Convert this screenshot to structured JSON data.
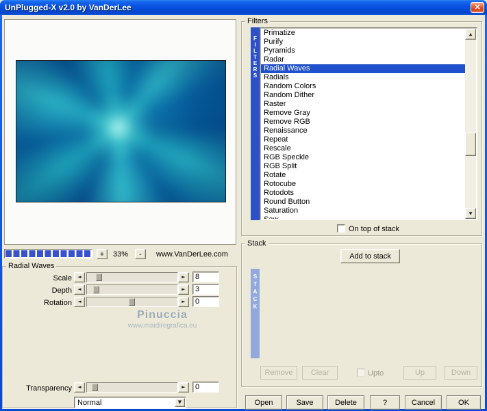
{
  "window": {
    "title": "UnPlugged-X v2.0 by VanDerLee"
  },
  "icons": {
    "close": "×",
    "left_arrow": "◄",
    "right_arrow": "►",
    "up_arrow": "▲",
    "down_arrow": "▼",
    "dropdown_arrow": "▼"
  },
  "preview": {
    "zoom_in_label": "+",
    "zoom_out_label": "-",
    "zoom_level": "33%",
    "website": "www.VanDerLee.com"
  },
  "radial_waves_panel": {
    "group_label": "Radial Waves",
    "params": [
      {
        "label": "Scale",
        "value": "8"
      },
      {
        "label": "Depth",
        "value": "3"
      },
      {
        "label": "Rotation",
        "value": "0"
      }
    ],
    "transparency": {
      "label": "Transparency",
      "value": "0"
    },
    "blend_mode": "Normal",
    "watermark": {
      "title": "Pinuccia",
      "url": "www.maidiregrafica.eu"
    }
  },
  "filters_panel": {
    "group_label": "Filters",
    "side_tab": "FILTERS",
    "selected": "Radial Waves",
    "items": [
      "Primatize",
      "Purify",
      "Pyramids",
      "Radar",
      "Radial Waves",
      "Radials",
      "Random Colors",
      "Random Dither",
      "Raster",
      "Remove Gray",
      "Remove RGB",
      "Renaissance",
      "Repeat",
      "Rescale",
      "RGB Speckle",
      "RGB Split",
      "Rotate",
      "Rotocube",
      "Rotodots",
      "Round Button",
      "Saturation",
      "Saw"
    ],
    "on_top_label": "On top of stack"
  },
  "stack_panel": {
    "group_label": "Stack",
    "side_tab": "STACK",
    "add_button": "Add to stack",
    "remove_button": "Remove",
    "clear_button": "Clear",
    "upto_label": "Upto",
    "up_button": "Up",
    "down_button": "Down"
  },
  "dialog_buttons": {
    "open": "Open",
    "save": "Save",
    "delete": "Delete",
    "help": "?",
    "cancel": "Cancel",
    "ok": "OK"
  },
  "colors": {
    "titlebar_blue": "#0a54e4",
    "selection_blue": "#2050cc",
    "filters_tab_blue": "#2b50c8",
    "stack_tab_blue": "#93a8dc",
    "progress_blue": "#3952cc",
    "dialog_bg": "#ece9d8",
    "preview_base_blue": "#0a4e86",
    "preview_cyan": "#45c8d0"
  }
}
